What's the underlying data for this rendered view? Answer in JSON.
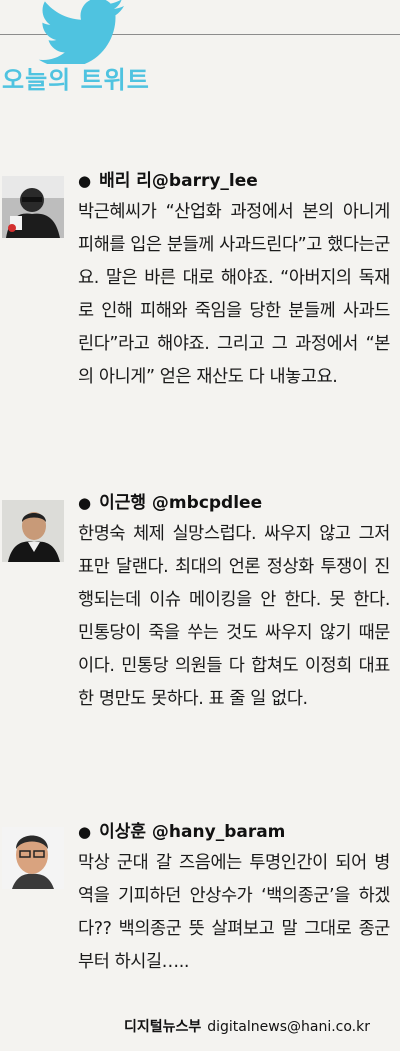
{
  "header": {
    "title": "오늘의 트위트"
  },
  "tweets": [
    {
      "author": "배리 리@barry_lee",
      "text": "박근혜씨가 “산업화 과정에서 본의 아니게 피해를 입은 분들께 사과드린다”고 했다는군요. 말은 바른 대로 해야죠. “아버지의 독재로 인해 피해와 죽임을 당한 분들께 사과드린다”라고 해야죠. 그리고 그 과정에서 “본의 아니게” 얻은 재산도 다 내놓고요."
    },
    {
      "author": "이근행 @mbcpdlee",
      "text": "한명숙 체제 실망스럽다. 싸우지 않고 그저 표만 달랜다. 최대의 언론 정상화 투쟁이 진행되는데 이슈 메이킹을 안 한다. 못 한다. 민통당이 죽을 쑤는 것도 싸우지 않기 때문이다. 민통당 의원들 다 합쳐도 이정희 대표 한 명만도 못하다. 표 줄 일 없다."
    },
    {
      "author": "이상훈 @hany_baram",
      "text": "막상 군대 갈 즈음에는 투명인간이 되어 병역을 기피하던 안상수가 ‘백의종군’을 하겠다?? 백의종군 뜻 살펴보고 말 그대로 종군부터 하시길….."
    }
  ],
  "byline": {
    "dept": "디지털뉴스부",
    "email": "digitalnews@hani.co.kr"
  },
  "colors": {
    "accent": "#4fc3e0",
    "background": "#f4f3f0"
  }
}
